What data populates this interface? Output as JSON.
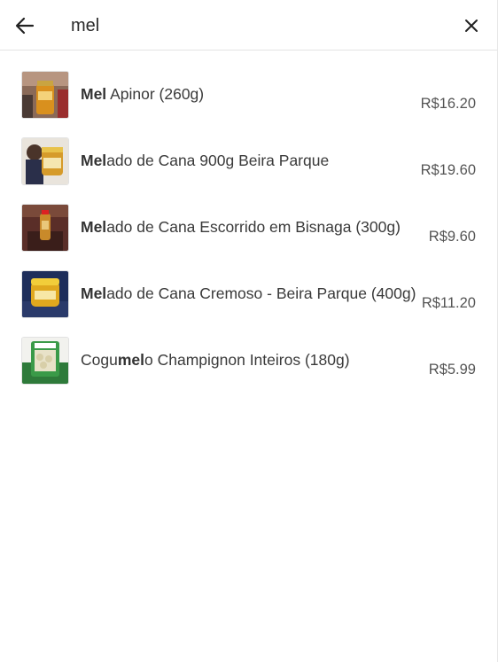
{
  "search": {
    "query": "mel",
    "back_icon": "arrow-left-icon",
    "clear_icon": "close-icon"
  },
  "results": [
    {
      "pre": "",
      "match": "Mel",
      "post": " Apinor (260g)",
      "price": "R$16.20",
      "thumb_icon": "honey-jar-photo"
    },
    {
      "pre": "",
      "match": "Mel",
      "post": "ado de Cana 900g Beira Parque",
      "price": "R$19.60",
      "thumb_icon": "melado-jar-photo"
    },
    {
      "pre": "",
      "match": "Mel",
      "post": "ado de Cana Escorrido em Bisnaga (300g)",
      "price": "R$9.60",
      "thumb_icon": "bisnaga-photo"
    },
    {
      "pre": "",
      "match": "Mel",
      "post": "ado de Cana Cremoso - Beira Parque (400g)",
      "price": "R$11.20",
      "thumb_icon": "cremoso-pot-photo"
    },
    {
      "pre": "Cogu",
      "match": "mel",
      "post": "o Champignon Inteiros (180g)",
      "price": "R$5.99",
      "thumb_icon": "mushroom-pack-photo"
    }
  ],
  "colors": {
    "text": "#3a3a3a",
    "price": "#555555",
    "divider": "#e3e3e3"
  }
}
